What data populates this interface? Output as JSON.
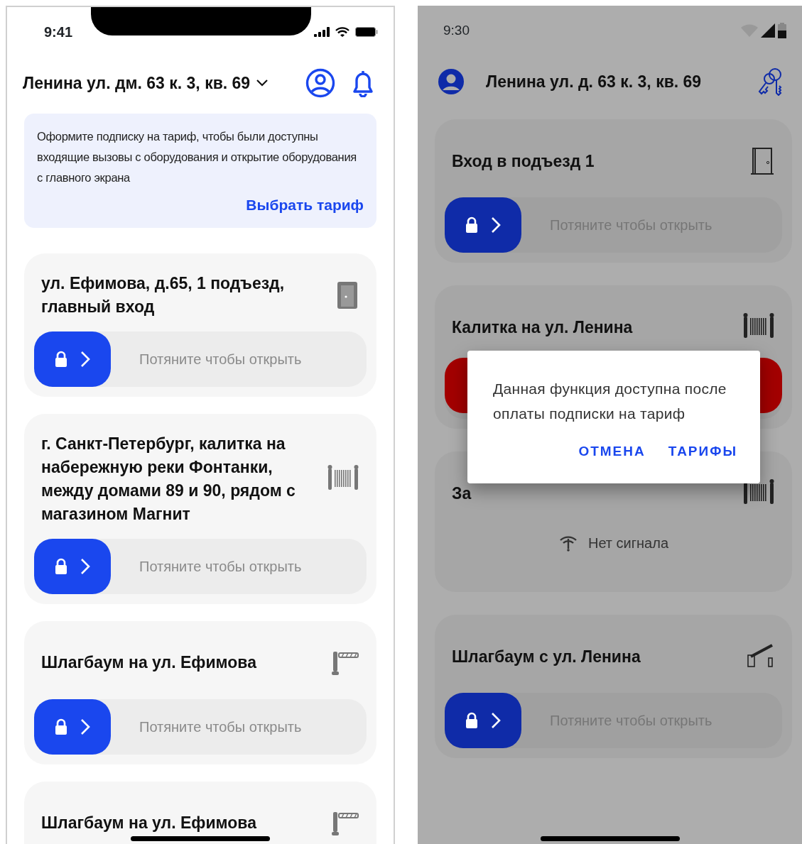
{
  "left_screen": {
    "status_bar": {
      "time": "9:41"
    },
    "address": "Ленина ул. дм. 63 к. 3, кв. 69",
    "banner": {
      "text": "Оформите подписку на тариф, чтобы были доступны входящие вызовы с оборудования и открытие оборудования с главного экрана",
      "link": "Выбрать тариф"
    },
    "devices": [
      {
        "kind": "door",
        "title": "ул. Ефимова, д.65, 1 подъезд, главный вход",
        "slider": {
          "kind": "normal",
          "hint": "Потяните чтобы открыть"
        }
      },
      {
        "kind": "gate",
        "title": "г. Санкт-Петербург, калитка на набережную реки Фонтанки, между домами 89 и 90, рядом с магазином Магнит",
        "slider": {
          "kind": "normal",
          "hint": "Потяните чтобы открыть"
        }
      },
      {
        "kind": "barrier",
        "title": "Шлагбаум на ул. Ефимова",
        "slider": {
          "kind": "normal",
          "hint": "Потяните чтобы открыть"
        }
      },
      {
        "kind": "barrier",
        "title": "Шлагбаум на ул. Ефимова"
      }
    ]
  },
  "right_screen": {
    "status_bar": {
      "time": "9:30"
    },
    "address": "Ленина ул. д. 63 к. 3, кв. 69",
    "devices": [
      {
        "kind": "door",
        "title": "Вход в подъезд 1",
        "slider": {
          "kind": "normal",
          "hint": "Потяните чтобы открыть"
        }
      },
      {
        "kind": "gate",
        "title": "Калитка на ул. Ленина",
        "slider": {
          "kind": "alert"
        }
      },
      {
        "kind": "gate",
        "title": "За",
        "status": "Нет сигнала"
      },
      {
        "kind": "barrier",
        "title": "Шлагбаум с ул. Ленина",
        "slider": {
          "kind": "normal",
          "hint": "Потяните чтобы открыть"
        }
      }
    ],
    "dialog": {
      "text": "Данная функция доступна после оплаты подписки на тариф",
      "buttons": [
        "ОТМЕНА",
        "ТАРИФЫ"
      ]
    }
  }
}
